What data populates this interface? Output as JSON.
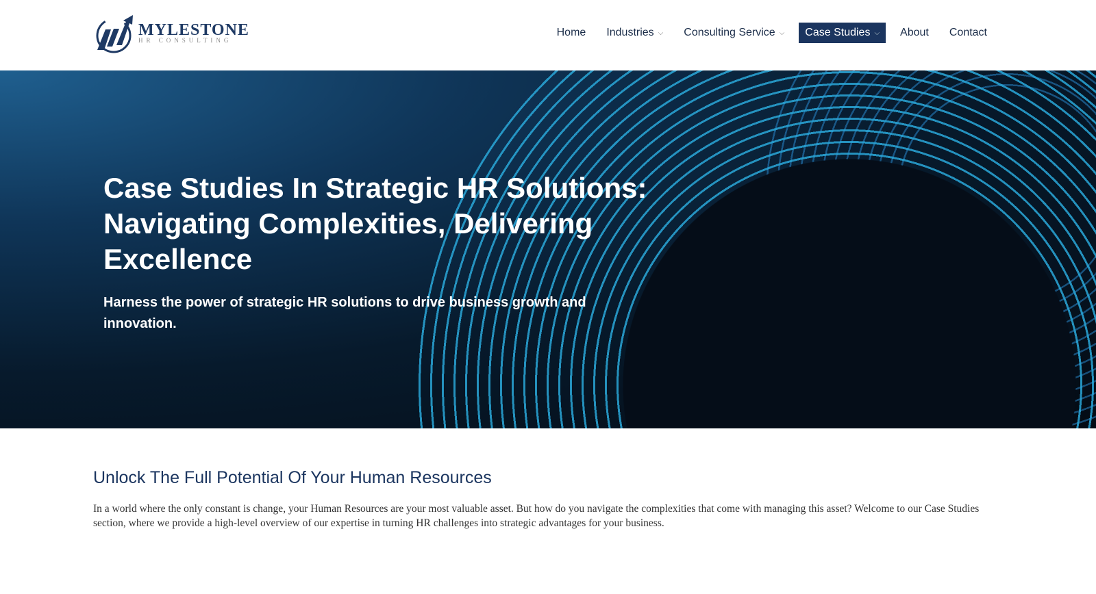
{
  "logo": {
    "name": "MYLESTONE",
    "sub": "HR CONSULTING"
  },
  "nav": [
    {
      "label": "Home",
      "dropdown": false
    },
    {
      "label": "Industries",
      "dropdown": true
    },
    {
      "label": "Consulting Service",
      "dropdown": true
    },
    {
      "label": "Case Studies",
      "dropdown": true,
      "active": true
    },
    {
      "label": "About",
      "dropdown": false
    },
    {
      "label": "Contact",
      "dropdown": false
    }
  ],
  "chevron": "⌵",
  "hero": {
    "title": "Case Studies In Strategic HR Solutions: Navigating Complexities, Delivering Excellence",
    "subtitle": "Harness the power of strategic HR solutions to drive business growth and innovation."
  },
  "intro": {
    "heading": "Unlock The Full Potential Of Your Human Resources",
    "body": "In a world where the only constant is change, your Human Resources are your most valuable asset. But how do you navigate the complexities that come with managing this asset? Welcome to our Case Studies section, where we provide a high-level overview of our expertise in turning HR challenges into strategic advantages for your business."
  },
  "colors": {
    "brand": "#1b355f",
    "ring": "#2aa7d8"
  }
}
